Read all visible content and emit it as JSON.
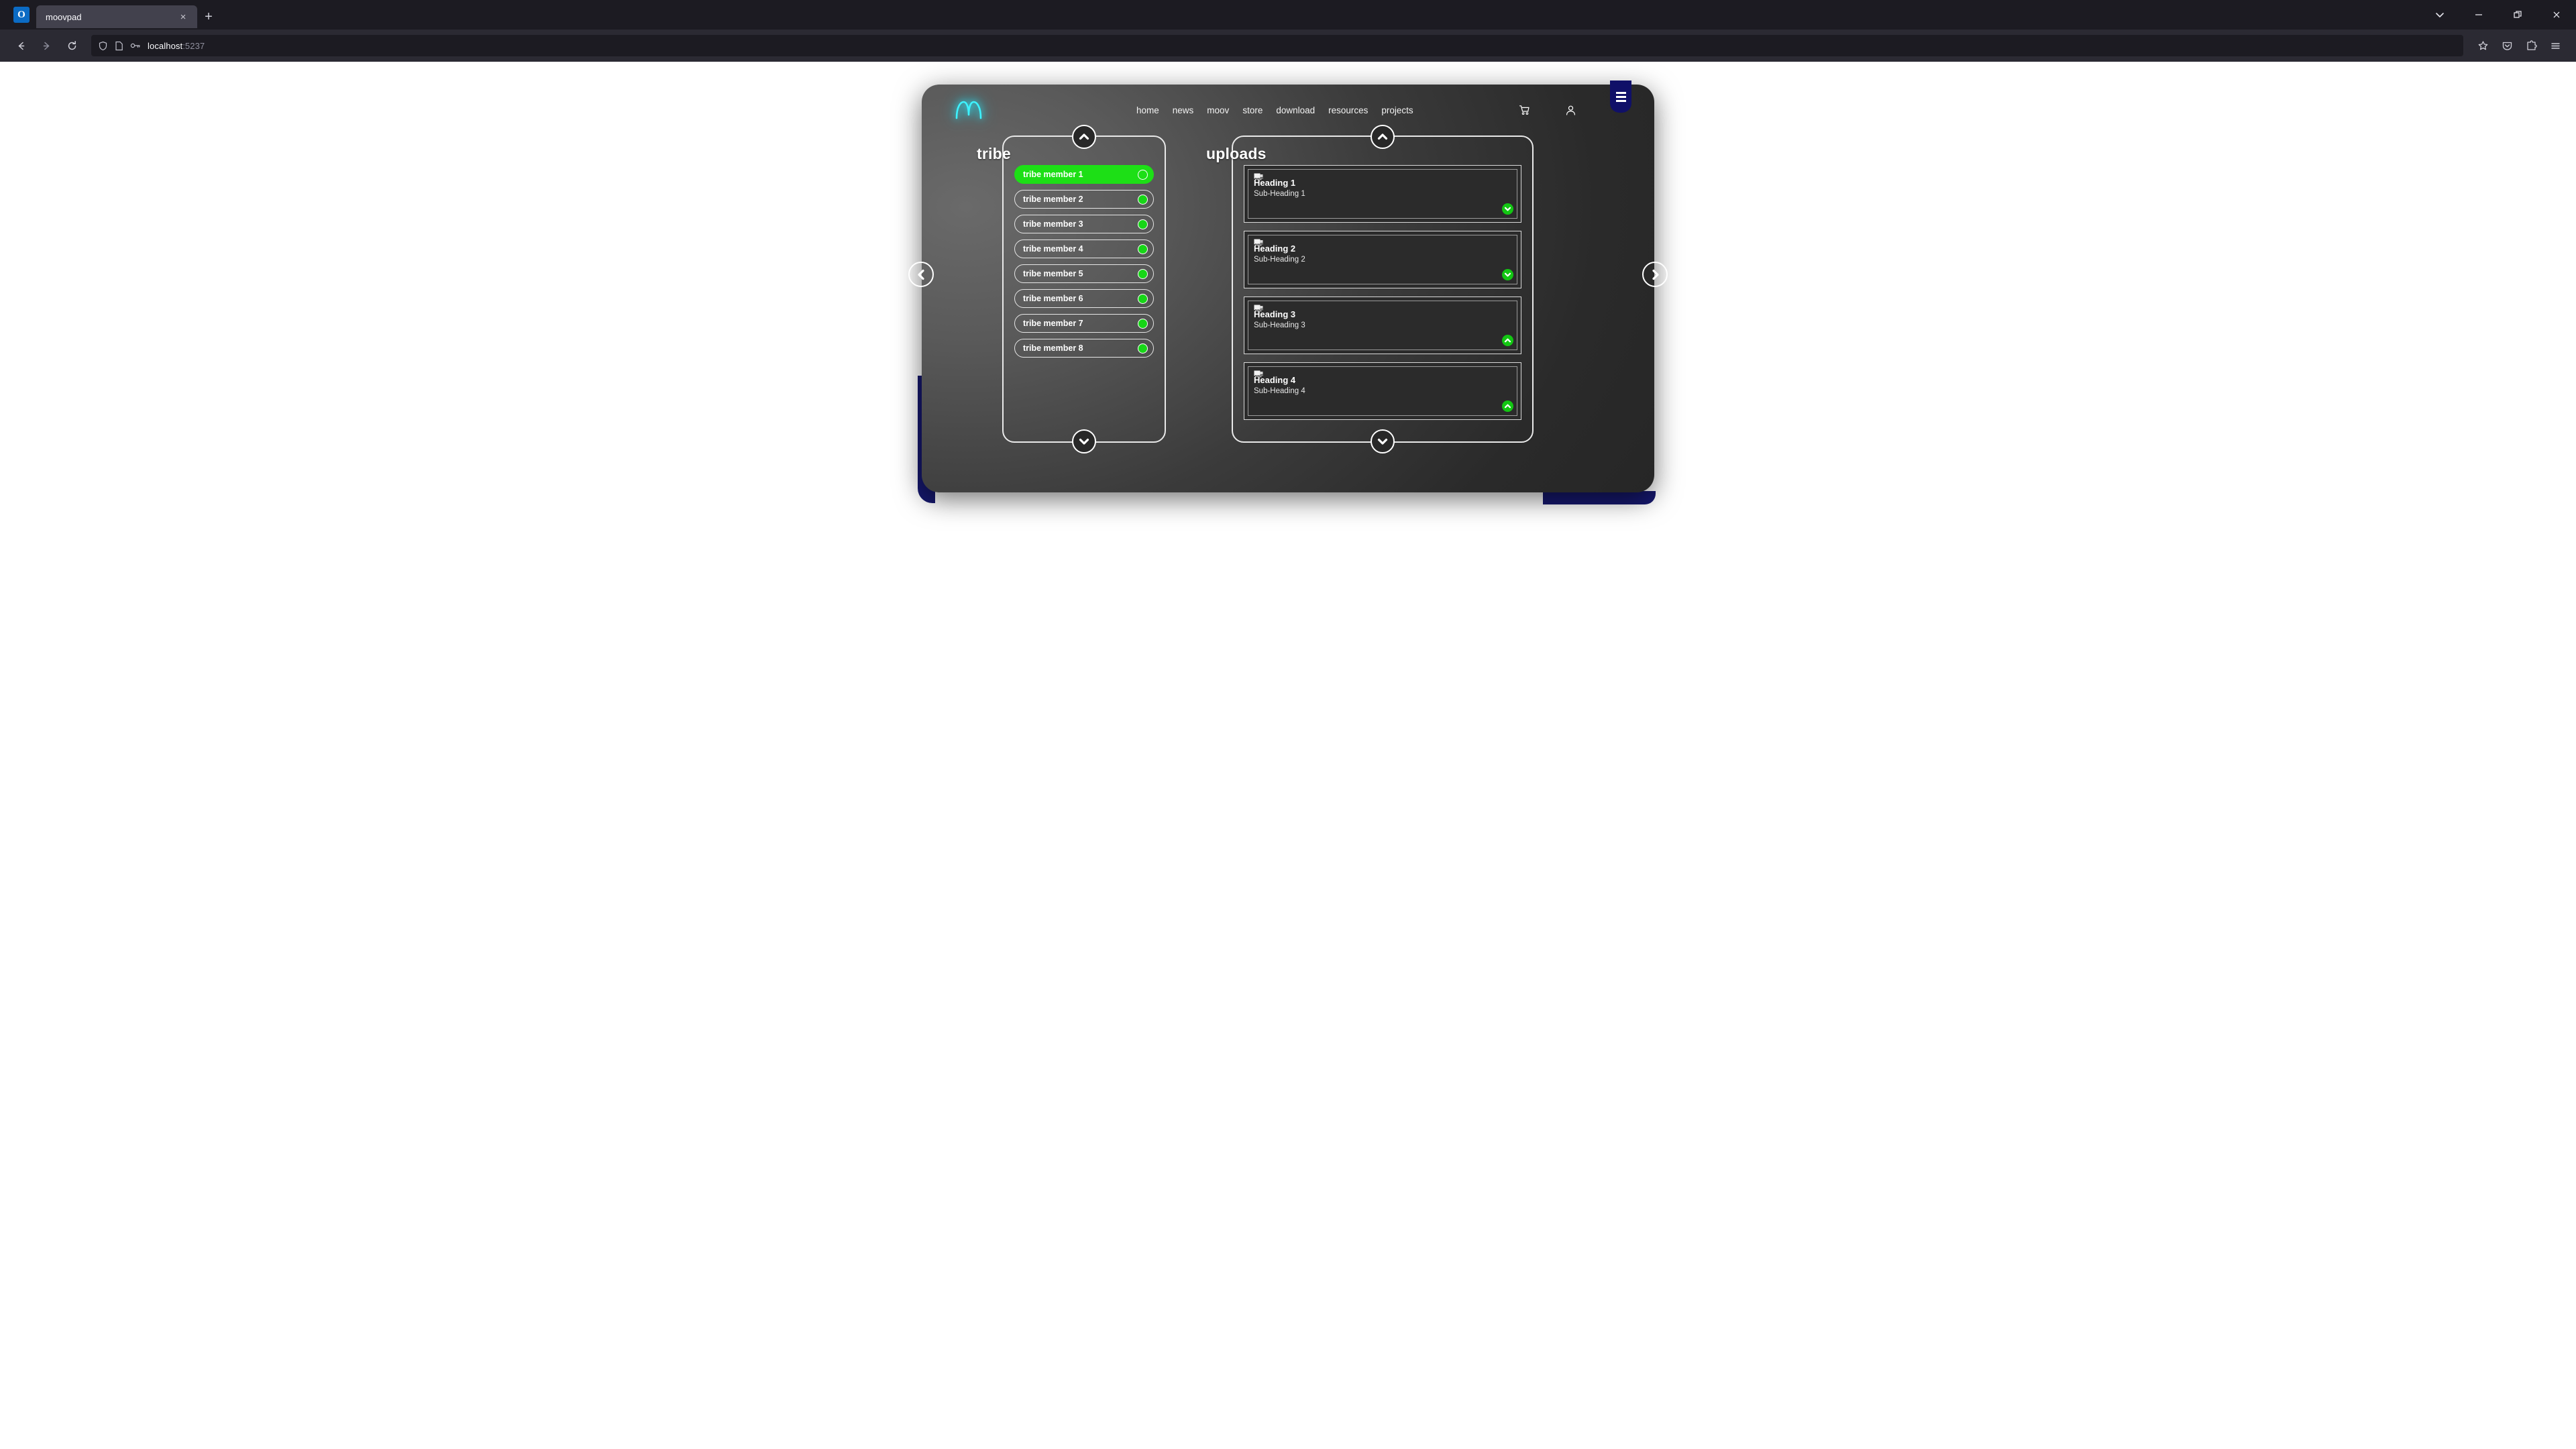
{
  "browser": {
    "tab": {
      "title": "moovpad",
      "close_label": "×"
    },
    "newtab_label": "+",
    "window_controls": {
      "tablist": "tab-list",
      "minimize": "minimize",
      "restore": "restore",
      "close": "close"
    },
    "nav": {
      "back": "back",
      "forward": "forward",
      "reload": "reload"
    },
    "url": {
      "host": "localhost",
      "port": ":5237",
      "shield": "shield-icon",
      "page": "page-icon",
      "key": "key-icon"
    },
    "toolbar_right": {
      "bookmark": "star-icon",
      "pocket": "pocket-icon",
      "extensions": "extensions-icon",
      "menu": "hamburger-icon"
    }
  },
  "app": {
    "logo_alt": "moov-logo",
    "nav": [
      {
        "label": "home"
      },
      {
        "label": "news"
      },
      {
        "label": "moov"
      },
      {
        "label": "store"
      },
      {
        "label": "download"
      },
      {
        "label": "resources"
      },
      {
        "label": "projects"
      }
    ],
    "icons": {
      "cart": "cart-icon",
      "account": "user-icon",
      "menu": "hamburger-icon"
    },
    "carousel": {
      "prev": "chevron-left-icon",
      "next": "chevron-right-icon"
    },
    "colors": {
      "accent_green": "#1ddf16",
      "dot_green": "#17d617",
      "chevron_green": "#13c613",
      "navy": "#16186e",
      "menu_tab_navy": "#101068",
      "logo_cyan": "#2ff0ff",
      "panel_border": "#e9e9e9"
    },
    "tribe_panel": {
      "title": "tribe",
      "scroll_up": "chevron-up-icon",
      "scroll_down": "chevron-down-icon",
      "members": [
        {
          "label": "tribe member 1",
          "active": true
        },
        {
          "label": "tribe member 2",
          "active": false
        },
        {
          "label": "tribe member 3",
          "active": false
        },
        {
          "label": "tribe member 4",
          "active": false
        },
        {
          "label": "tribe member 5",
          "active": false
        },
        {
          "label": "tribe member 6",
          "active": false
        },
        {
          "label": "tribe member 7",
          "active": false
        },
        {
          "label": "tribe member 8",
          "active": false
        }
      ]
    },
    "uploads_panel": {
      "title": "uploads",
      "scroll_up": "chevron-up-icon",
      "scroll_down": "chevron-down-icon",
      "cards": [
        {
          "heading": "Heading 1",
          "subheading": "Sub-Heading 1",
          "chevron": "down",
          "thumb": "broken-image-icon"
        },
        {
          "heading": "Heading 2",
          "subheading": "Sub-Heading 2",
          "chevron": "down",
          "thumb": "broken-image-icon"
        },
        {
          "heading": "Heading 3",
          "subheading": "Sub-Heading 3",
          "chevron": "up",
          "thumb": "broken-image-icon"
        },
        {
          "heading": "Heading 4",
          "subheading": "Sub-Heading 4",
          "chevron": "up",
          "thumb": "broken-image-icon"
        }
      ]
    }
  }
}
